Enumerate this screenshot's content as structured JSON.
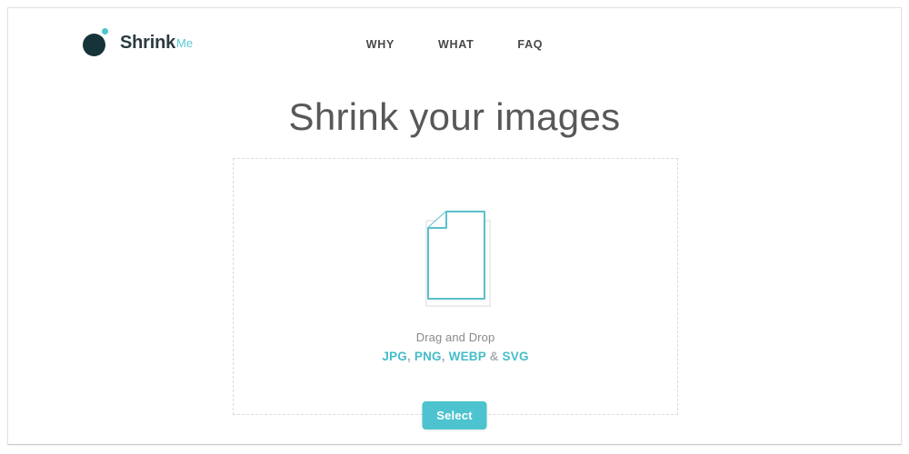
{
  "brand": {
    "name": "Shrink",
    "suffix": "Me",
    "mark_icon": "circle-dot-logo-icon",
    "dot_color": "#4ec6d2",
    "blob_color": "#17333a"
  },
  "nav": {
    "items": [
      {
        "label": "WHY"
      },
      {
        "label": "WHAT"
      },
      {
        "label": "FAQ"
      }
    ]
  },
  "hero": {
    "title": "Shrink your images"
  },
  "dropzone": {
    "icon": "document-file-icon",
    "caption": "Drag and Drop",
    "formats": [
      {
        "name": "JPG",
        "separator": ","
      },
      {
        "name": "PNG",
        "separator": ","
      },
      {
        "name": "WEBP",
        "separator": "&"
      },
      {
        "name": "SVG",
        "separator": ""
      }
    ],
    "formats_text": "JPG, PNG, WEBP & SVG",
    "select_label": "Select"
  },
  "colors": {
    "accent": "#4cc3ce",
    "accent_text": "#46bcc9",
    "heading": "#58585a",
    "body_text": "#8a8a8a",
    "dashed_border": "#dcdcdc",
    "icon_outline": "#5bbfcb",
    "icon_shadow": "#ededed"
  }
}
